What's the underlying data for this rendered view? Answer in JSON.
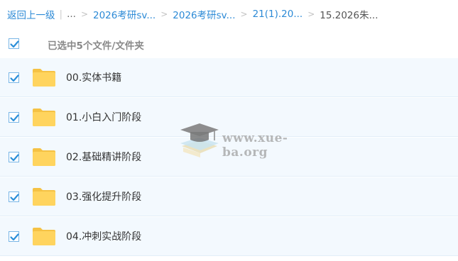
{
  "breadcrumb": {
    "back": "返回上一级",
    "dots": "...",
    "items": [
      "2026考研sv...",
      "2026考研sv...",
      "21(1).20..."
    ],
    "current": "15.2026朱..."
  },
  "selection": {
    "label": "已选中5个文件/文件夹",
    "checked": true
  },
  "files": [
    {
      "name": "00.实体书籍",
      "checked": true,
      "icon": "folder-icon"
    },
    {
      "name": "01.小白入门阶段",
      "checked": true,
      "icon": "folder-icon"
    },
    {
      "name": "02.基础精讲阶段",
      "checked": true,
      "icon": "folder-icon"
    },
    {
      "name": "03.强化提升阶段",
      "checked": true,
      "icon": "folder-icon"
    },
    {
      "name": "04.冲刺实战阶段",
      "checked": true,
      "icon": "folder-icon"
    }
  ],
  "watermark": {
    "text": "www.xue-ba.org",
    "icon": "graduation-cap-icon"
  },
  "colors": {
    "link": "#2c8ad6",
    "row_bg": "#f3f9fe",
    "check": "#2b8fd9",
    "folder": "#ffd45e"
  }
}
